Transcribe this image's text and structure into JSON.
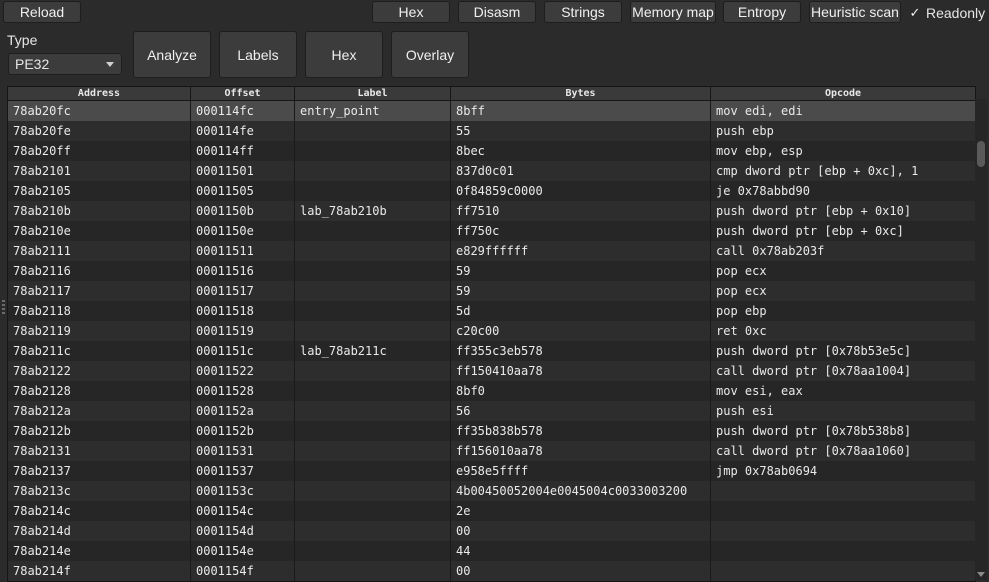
{
  "toolbar": {
    "reload": "Reload",
    "tabs": [
      "Hex",
      "Disasm",
      "Strings",
      "Memory map",
      "Entropy",
      "Heuristic scan"
    ],
    "readonly_label": "Readonly",
    "readonly_checked": true,
    "readonly_mark": "✓"
  },
  "left_panel": {
    "type_label": "Type",
    "type_value": "PE32"
  },
  "actions": [
    "Analyze",
    "Labels",
    "Hex",
    "Overlay"
  ],
  "table": {
    "columns": [
      "Address",
      "Offset",
      "Label",
      "Bytes",
      "Opcode"
    ],
    "selected_row": 0,
    "rows": [
      [
        "78ab20fc",
        "000114fc",
        "entry_point",
        "8bff",
        "mov edi, edi"
      ],
      [
        "78ab20fe",
        "000114fe",
        "",
        "55",
        "push ebp"
      ],
      [
        "78ab20ff",
        "000114ff",
        "",
        "8bec",
        "mov ebp, esp"
      ],
      [
        "78ab2101",
        "00011501",
        "",
        "837d0c01",
        "cmp dword ptr [ebp + 0xc], 1"
      ],
      [
        "78ab2105",
        "00011505",
        "",
        "0f84859c0000",
        "je 0x78abbd90"
      ],
      [
        "78ab210b",
        "0001150b",
        "lab_78ab210b",
        "ff7510",
        "push dword ptr [ebp + 0x10]"
      ],
      [
        "78ab210e",
        "0001150e",
        "",
        "ff750c",
        "push dword ptr [ebp + 0xc]"
      ],
      [
        "78ab2111",
        "00011511",
        "",
        "e829ffffff",
        "call 0x78ab203f"
      ],
      [
        "78ab2116",
        "00011516",
        "",
        "59",
        "pop ecx"
      ],
      [
        "78ab2117",
        "00011517",
        "",
        "59",
        "pop ecx"
      ],
      [
        "78ab2118",
        "00011518",
        "",
        "5d",
        "pop ebp"
      ],
      [
        "78ab2119",
        "00011519",
        "",
        "c20c00",
        "ret 0xc"
      ],
      [
        "78ab211c",
        "0001151c",
        "lab_78ab211c",
        "ff355c3eb578",
        "push dword ptr [0x78b53e5c]"
      ],
      [
        "78ab2122",
        "00011522",
        "",
        "ff150410aa78",
        "call dword ptr [0x78aa1004]"
      ],
      [
        "78ab2128",
        "00011528",
        "",
        "8bf0",
        "mov esi, eax"
      ],
      [
        "78ab212a",
        "0001152a",
        "",
        "56",
        "push esi"
      ],
      [
        "78ab212b",
        "0001152b",
        "",
        "ff35b838b578",
        "push dword ptr [0x78b538b8]"
      ],
      [
        "78ab2131",
        "00011531",
        "",
        "ff156010aa78",
        "call dword ptr [0x78aa1060]"
      ],
      [
        "78ab2137",
        "00011537",
        "",
        "e958e5ffff",
        "jmp 0x78ab0694"
      ],
      [
        "78ab213c",
        "0001153c",
        "",
        "4b00450052004e0045004c0033003200",
        ""
      ],
      [
        "78ab214c",
        "0001154c",
        "",
        "2e",
        ""
      ],
      [
        "78ab214d",
        "0001154d",
        "",
        "00",
        ""
      ],
      [
        "78ab214e",
        "0001154e",
        "",
        "44",
        ""
      ],
      [
        "78ab214f",
        "0001154f",
        "",
        "00",
        ""
      ]
    ]
  },
  "colors": {
    "background": "#2b2b2b",
    "selected_row": "#4b4b4b",
    "text": "#e6e6e6"
  }
}
